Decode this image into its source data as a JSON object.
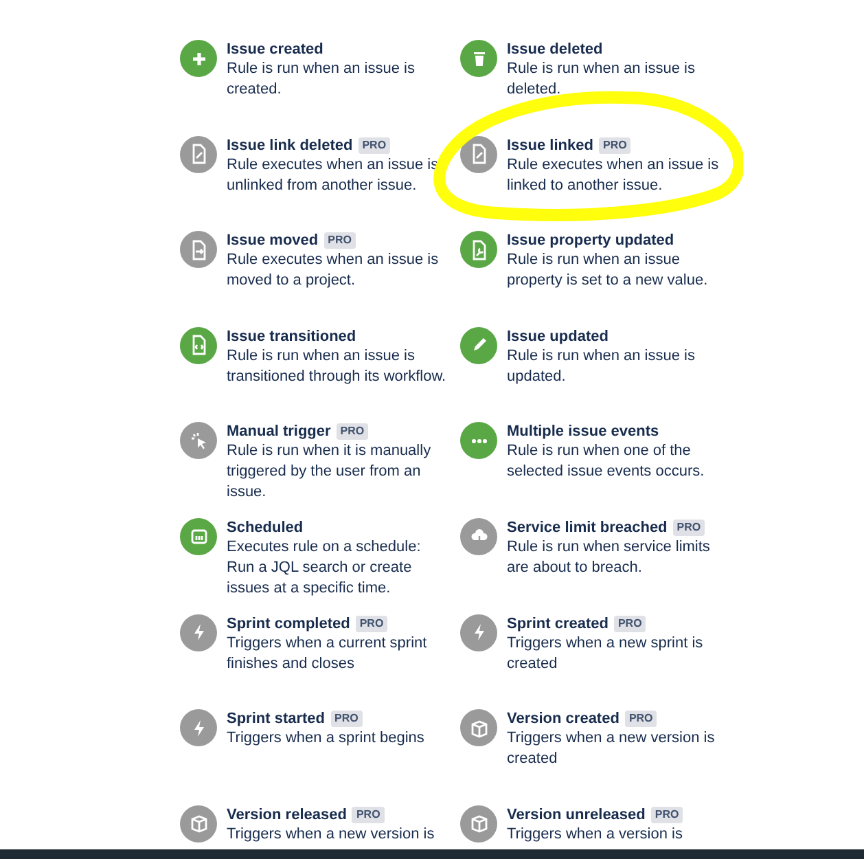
{
  "triggers": [
    {
      "title": "Issue created",
      "kind": "plus",
      "color": "#5aa845",
      "description": "Rule is run when an issue is created."
    },
    {
      "title": "Issue deleted",
      "kind": "trash",
      "color": "#5aa845",
      "description": "Rule is run when an issue is deleted."
    },
    {
      "title": "Issue link deleted",
      "badge": "PRO",
      "kind": "link-doc",
      "color": "#9a9a9a",
      "description": "Rule executes when an issue is unlinked from another issue."
    },
    {
      "title": "Issue linked",
      "badge": "PRO",
      "kind": "link-doc",
      "color": "#9a9a9a",
      "description": "Rule executes when an issue is linked to another issue.",
      "highlighted": true
    },
    {
      "title": "Issue moved",
      "badge": "PRO",
      "kind": "move-doc",
      "color": "#9a9a9a",
      "description": "Rule executes when an issue is moved to a project."
    },
    {
      "title": "Issue property updated",
      "kind": "wrench-doc",
      "color": "#5aa845",
      "description": "Rule is run when an issue property is set to a new value."
    },
    {
      "title": "Issue transitioned",
      "kind": "code-doc",
      "color": "#5aa845",
      "description": "Rule is run when an issue is transitioned through its workflow."
    },
    {
      "title": "Issue updated",
      "kind": "pencil",
      "color": "#5aa845",
      "description": "Rule is run when an issue is updated."
    },
    {
      "title": "Manual trigger",
      "badge": "PRO",
      "kind": "cursor",
      "color": "#9a9a9a",
      "description": "Rule is run when it is manually triggered by the user from an issue."
    },
    {
      "title": "Multiple issue events",
      "kind": "dots",
      "color": "#5aa845",
      "description": "Rule is run when one of the selected issue events occurs."
    },
    {
      "title": "Scheduled",
      "kind": "calendar",
      "color": "#5aa845",
      "description": "Executes rule on a schedule: Run a JQL search or create issues at a specific time."
    },
    {
      "title": "Service limit breached",
      "badge": "PRO",
      "kind": "cloud",
      "color": "#9a9a9a",
      "description": "Rule is run when service limits are about to breach."
    },
    {
      "title": "Sprint completed",
      "badge": "PRO",
      "kind": "bolt",
      "color": "#9a9a9a",
      "description": "Triggers when a current sprint finishes and closes"
    },
    {
      "title": "Sprint created",
      "badge": "PRO",
      "kind": "bolt",
      "color": "#9a9a9a",
      "description": "Triggers when a new sprint is created"
    },
    {
      "title": "Sprint started",
      "badge": "PRO",
      "kind": "bolt",
      "color": "#9a9a9a",
      "description": "Triggers when a sprint begins"
    },
    {
      "title": "Version created",
      "badge": "PRO",
      "kind": "box",
      "color": "#9a9a9a",
      "description": "Triggers when a new version is created"
    },
    {
      "title": "Version released",
      "badge": "PRO",
      "kind": "box",
      "color": "#9a9a9a",
      "description": "Triggers when a new version is"
    },
    {
      "title": "Version unreleased",
      "badge": "PRO",
      "kind": "box",
      "color": "#9a9a9a",
      "description": "Triggers when a version is"
    }
  ]
}
